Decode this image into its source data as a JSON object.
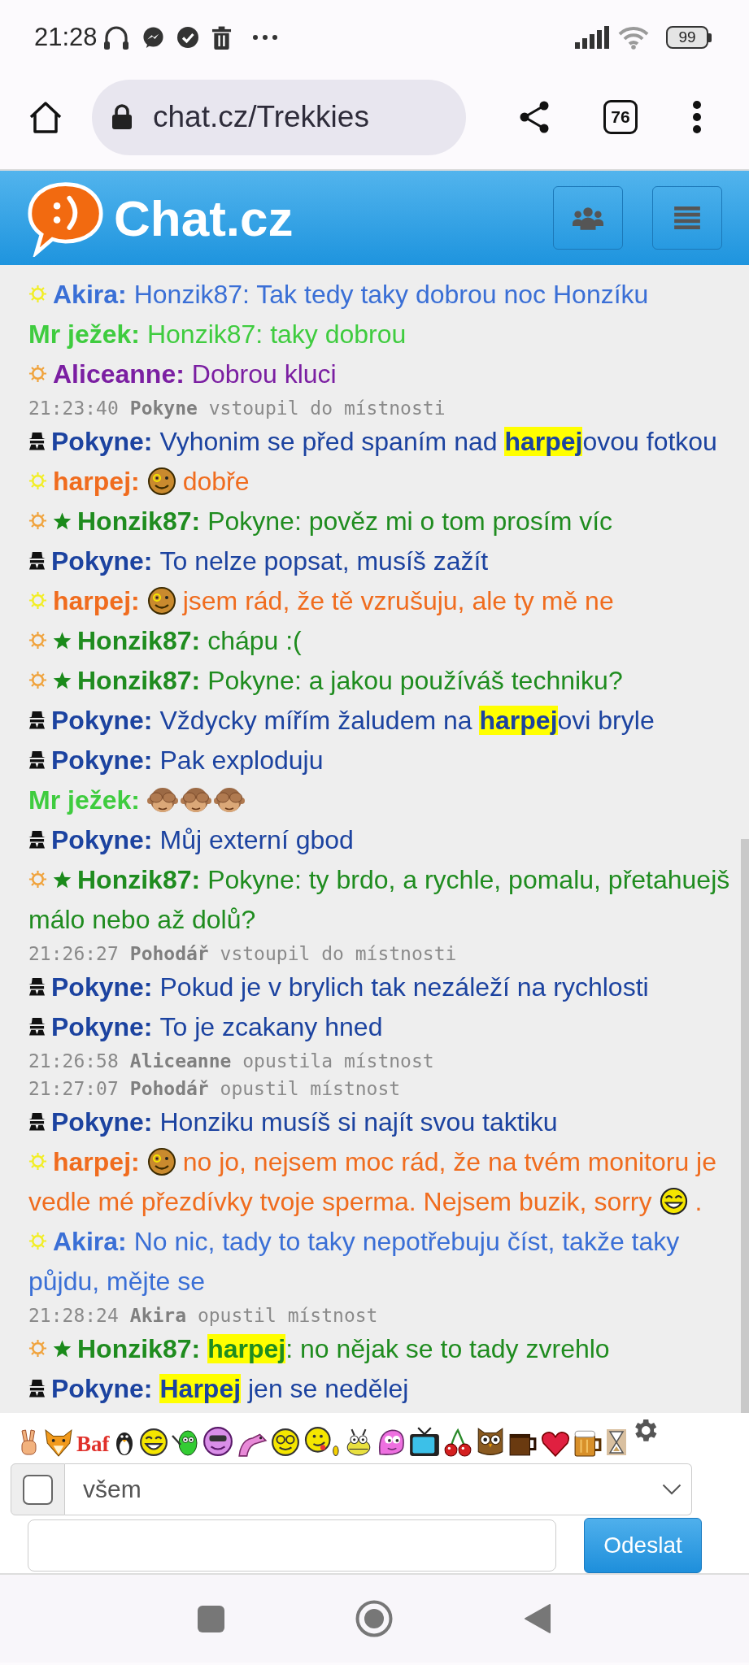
{
  "status_bar": {
    "time": "21:28",
    "battery": "99"
  },
  "browser": {
    "url": "chat.cz/Trekkies",
    "tab_count": "76"
  },
  "header": {
    "title": "Chat.cz"
  },
  "messages": [
    {
      "kind": "message",
      "badges": [
        {
          "kind": "sun",
          "color": "#f2ee22"
        }
      ],
      "nick": "Akira:",
      "color": "#3a6fd6",
      "segments": [
        {
          "kind": "text",
          "text": "Honzik87: Tak tedy taky dobrou noc Honzíku"
        }
      ]
    },
    {
      "kind": "message",
      "nick": "Mr ježek:",
      "color": "#3fcc3f",
      "segments": [
        {
          "kind": "text",
          "text": "Honzik87: taky dobrou"
        }
      ]
    },
    {
      "kind": "message",
      "badges": [
        {
          "kind": "sun",
          "color": "#f0a23a"
        }
      ],
      "nick": "Aliceanne:",
      "color": "#7b1fa2",
      "segments": [
        {
          "kind": "text",
          "text": "Dobrou kluci"
        }
      ]
    },
    {
      "kind": "system",
      "time": "21:23:40",
      "text": "**Pokyne** vstoupil do místnosti"
    },
    {
      "kind": "message",
      "badges": [
        {
          "kind": "spy"
        }
      ],
      "nick": "Pokyne:",
      "color": "#1c43a0",
      "segments": [
        {
          "kind": "text",
          "text": "Vyhonim se před spaním nad "
        },
        {
          "kind": "mention",
          "text": "harpej"
        },
        {
          "kind": "text",
          "text": "ovou fotkou"
        }
      ]
    },
    {
      "kind": "message",
      "badges": [
        {
          "kind": "sun",
          "color": "#f2ee22"
        }
      ],
      "nick": "harpej:",
      "color": "#f06c1e",
      "segments": [
        {
          "kind": "smiley"
        },
        {
          "kind": "text",
          "text": "dobře"
        }
      ]
    },
    {
      "kind": "message",
      "badges": [
        {
          "kind": "sun",
          "color": "#f0a23a"
        },
        {
          "kind": "star"
        }
      ],
      "nick": "Honzik87:",
      "color": "#1f8c1f",
      "segments": [
        {
          "kind": "text",
          "text": "Pokyne: pověz mi o tom prosím víc"
        }
      ]
    },
    {
      "kind": "message",
      "badges": [
        {
          "kind": "spy"
        }
      ],
      "nick": "Pokyne:",
      "color": "#1c43a0",
      "segments": [
        {
          "kind": "text",
          "text": "To nelze popsat, musíš zažít"
        }
      ]
    },
    {
      "kind": "message",
      "badges": [
        {
          "kind": "sun",
          "color": "#f2ee22"
        }
      ],
      "nick": "harpej:",
      "color": "#f06c1e",
      "segments": [
        {
          "kind": "smiley"
        },
        {
          "kind": "text",
          "text": "jsem rád, že tě vzrušuju, ale ty mě ne"
        }
      ]
    },
    {
      "kind": "message",
      "badges": [
        {
          "kind": "sun",
          "color": "#f0a23a"
        },
        {
          "kind": "star"
        }
      ],
      "nick": "Honzik87:",
      "color": "#1f8c1f",
      "segments": [
        {
          "kind": "text",
          "text": "chápu :("
        }
      ]
    },
    {
      "kind": "message",
      "badges": [
        {
          "kind": "sun",
          "color": "#f0a23a"
        },
        {
          "kind": "star"
        }
      ],
      "nick": "Honzik87:",
      "color": "#1f8c1f",
      "segments": [
        {
          "kind": "text",
          "text": "Pokyne: a jakou používáš techniku?"
        }
      ]
    },
    {
      "kind": "message",
      "badges": [
        {
          "kind": "spy"
        }
      ],
      "nick": "Pokyne:",
      "color": "#1c43a0",
      "segments": [
        {
          "kind": "text",
          "text": "Vždycky mířím žaludem na "
        },
        {
          "kind": "mention",
          "text": "harpej"
        },
        {
          "kind": "text",
          "text": "ovi bryle"
        }
      ]
    },
    {
      "kind": "message",
      "badges": [
        {
          "kind": "spy"
        }
      ],
      "nick": "Pokyne:",
      "color": "#1c43a0",
      "segments": [
        {
          "kind": "text",
          "text": "Pak exploduju"
        }
      ]
    },
    {
      "kind": "message",
      "nick": "Mr ježek:",
      "color": "#3fcc3f",
      "segments": [
        {
          "kind": "monkey"
        },
        {
          "kind": "monkey"
        },
        {
          "kind": "monkey"
        }
      ]
    },
    {
      "kind": "message",
      "badges": [
        {
          "kind": "spy"
        }
      ],
      "nick": "Pokyne:",
      "color": "#1c43a0",
      "segments": [
        {
          "kind": "text",
          "text": "Můj externí gbod"
        }
      ]
    },
    {
      "kind": "message",
      "badges": [
        {
          "kind": "sun",
          "color": "#f0a23a"
        },
        {
          "kind": "star"
        }
      ],
      "nick": "Honzik87:",
      "color": "#1f8c1f",
      "segments": [
        {
          "kind": "text",
          "text": "Pokyne: ty brdo, a rychle, pomalu, přetahuejš"
        },
        {
          "kind": "break"
        },
        {
          "kind": "text",
          "text": "málo nebo až dolů?"
        }
      ]
    },
    {
      "kind": "system",
      "time": "21:26:27",
      "text": "**Pohodář** vstoupil do místnosti"
    },
    {
      "kind": "message",
      "badges": [
        {
          "kind": "spy"
        }
      ],
      "nick": "Pokyne:",
      "color": "#1c43a0",
      "segments": [
        {
          "kind": "text",
          "text": "Pokud je v brylich tak nezáleží na rychlosti"
        }
      ]
    },
    {
      "kind": "message",
      "badges": [
        {
          "kind": "spy"
        }
      ],
      "nick": "Pokyne:",
      "color": "#1c43a0",
      "segments": [
        {
          "kind": "text",
          "text": "To je zcakany hned"
        }
      ]
    },
    {
      "kind": "system",
      "time": "21:26:58",
      "text": "**Aliceanne** opustila místnost"
    },
    {
      "kind": "system",
      "time": "21:27:07",
      "text": "**Pohodář** opustil místnost"
    },
    {
      "kind": "message",
      "badges": [
        {
          "kind": "spy"
        }
      ],
      "nick": "Pokyne:",
      "color": "#1c43a0",
      "segments": [
        {
          "kind": "text",
          "text": "Honziku musíš si najít svou taktiku"
        }
      ]
    },
    {
      "kind": "message",
      "badges": [
        {
          "kind": "sun",
          "color": "#f2ee22"
        }
      ],
      "nick": "harpej:",
      "color": "#f06c1e",
      "segments": [
        {
          "kind": "smiley"
        },
        {
          "kind": "text",
          "text": "no jo, nejsem moc rád, že na tvém monitoru je"
        },
        {
          "kind": "break"
        },
        {
          "kind": "text",
          "text": "vedle mé přezdívky tvoje sperma. Nejsem buzik, sorry"
        },
        {
          "kind": "grin"
        },
        {
          "kind": "text",
          "text": "."
        }
      ]
    },
    {
      "kind": "message",
      "badges": [
        {
          "kind": "sun",
          "color": "#f2ee22"
        }
      ],
      "nick": "Akira:",
      "color": "#3a6fd6",
      "segments": [
        {
          "kind": "text",
          "text": "No nic, tady to taky nepotřebuju číst, takže taky"
        },
        {
          "kind": "break"
        },
        {
          "kind": "text",
          "text": "půjdu, mějte se"
        }
      ]
    },
    {
      "kind": "system",
      "time": "21:28:24",
      "text": "**Akira** opustil místnost"
    },
    {
      "kind": "message",
      "badges": [
        {
          "kind": "sun",
          "color": "#f0a23a"
        },
        {
          "kind": "star"
        }
      ],
      "nick": "Honzik87:",
      "color": "#1f8c1f",
      "segments": [
        {
          "kind": "mention",
          "text": "harpej"
        },
        {
          "kind": "text",
          "text": ": no nějak se to tady zvrehlo"
        }
      ]
    },
    {
      "kind": "message",
      "badges": [
        {
          "kind": "spy"
        }
      ],
      "nick": "Pokyne:",
      "color": "#1c43a0",
      "segments": [
        {
          "kind": "mention",
          "text": "Harpej"
        },
        {
          "kind": "text",
          "text": " jen se nedělej"
        }
      ]
    }
  ],
  "composer": {
    "emoticon_text": "Baf",
    "checkbox": {
      "checked": false
    },
    "recipient": "všem",
    "send_label": "Odeslat"
  }
}
